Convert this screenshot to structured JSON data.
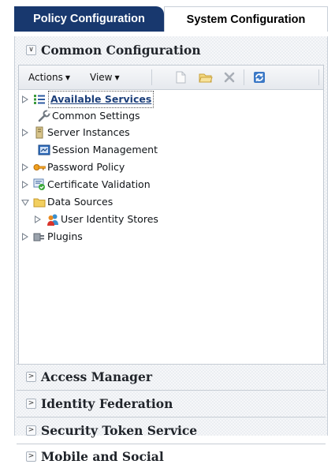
{
  "tabs": [
    {
      "label": "Policy Configuration",
      "active": false
    },
    {
      "label": "System Configuration",
      "active": true
    }
  ],
  "common_configuration": {
    "title": "Common Configuration",
    "expanded": true,
    "toolbar": {
      "actions_label": "Actions",
      "view_label": "View",
      "icons": [
        "new-document-icon",
        "open-folder-icon",
        "delete-icon",
        "refresh-icon"
      ]
    },
    "tree": [
      {
        "label": "Available Services",
        "icon": "services-list-icon",
        "expander": "collapsed",
        "selected": true
      },
      {
        "label": "Common Settings",
        "icon": "wrench-icon",
        "expander": "none"
      },
      {
        "label": "Server Instances",
        "icon": "server-icon",
        "expander": "collapsed"
      },
      {
        "label": "Session Management",
        "icon": "session-icon",
        "expander": "none"
      },
      {
        "label": "Password Policy",
        "icon": "key-icon",
        "expander": "collapsed"
      },
      {
        "label": "Certificate Validation",
        "icon": "certificate-icon",
        "expander": "collapsed"
      },
      {
        "label": "Data Sources",
        "icon": "folder-icon",
        "expander": "expanded"
      },
      {
        "label": "User Identity Stores",
        "icon": "users-icon",
        "expander": "collapsed"
      },
      {
        "label": "Plugins",
        "icon": "plugin-icon",
        "expander": "collapsed"
      }
    ]
  },
  "sections": [
    {
      "label": "Access Manager",
      "expanded": false
    },
    {
      "label": "Identity Federation",
      "expanded": false
    },
    {
      "label": "Security Token Service",
      "expanded": false
    },
    {
      "label": "Mobile and Social",
      "expanded": false
    }
  ],
  "colors": {
    "active_tab_background": "#18386e",
    "selected_node_text": "#1c3f7a"
  }
}
